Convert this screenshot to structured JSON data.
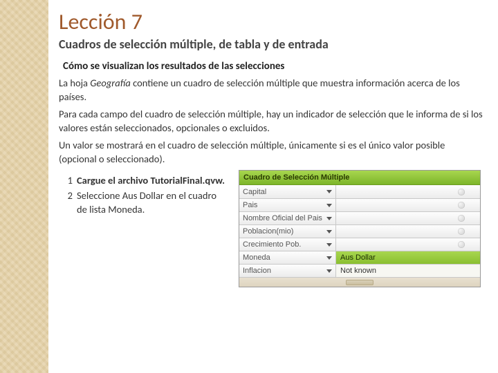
{
  "title": "Lección 7",
  "subtitle": "Cuadros de selección múltiple, de tabla y de entrada",
  "section_heading": "Cómo se visualizan los resultados de las selecciones",
  "p1_a": "La hoja ",
  "p1_em": "Geografía",
  "p1_b": " contiene un cuadro de selección múltiple que muestra información acerca de los países.",
  "p2": "Para cada campo del cuadro de selección múltiple, hay un indicador de selección que le informa de si los valores están seleccionados, opcionales o excluidos.",
  "p3": "Un valor se mostrará en el cuadro de selección múltiple, únicamente si es el único valor posible (opcional o seleccionado).",
  "steps": [
    {
      "num": "1",
      "text_bold": "Cargue el archivo TutorialFinal.qvw."
    },
    {
      "num": "2",
      "a": "Seleccione ",
      "em1": "Aus Dollar",
      "b": " en el cuadro de lista ",
      "em2": "Moneda",
      "c": "."
    }
  ],
  "multibox": {
    "header": "Cuadro de Selección Múltiple",
    "rows": [
      {
        "label": "Capital",
        "value": "",
        "state": "empty",
        "indicator": true
      },
      {
        "label": "Pais",
        "value": "",
        "state": "empty",
        "indicator": true
      },
      {
        "label": "Nombre Oficial del Pais",
        "value": "",
        "state": "empty",
        "indicator": true
      },
      {
        "label": "Poblacion(mio)",
        "value": "",
        "state": "empty",
        "indicator": true
      },
      {
        "label": "Crecimiento Pob.",
        "value": "",
        "state": "empty",
        "indicator": true
      },
      {
        "label": "Moneda",
        "value": "Aus Dollar",
        "state": "selected",
        "indicator": false
      },
      {
        "label": "Inflacion",
        "value": "Not known",
        "state": "optional",
        "indicator": false
      }
    ]
  }
}
